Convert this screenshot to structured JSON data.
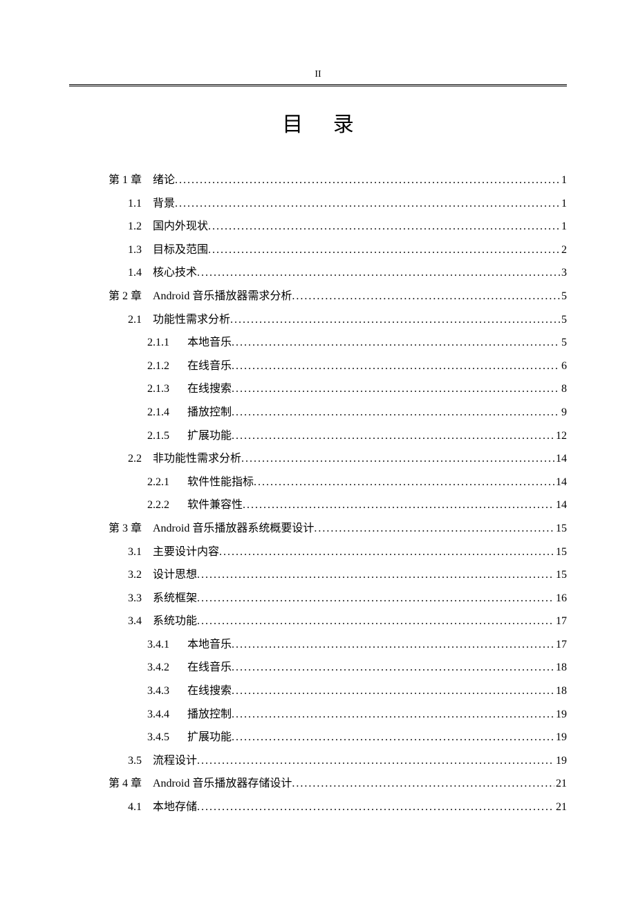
{
  "header": {
    "pageNumber": "II"
  },
  "title": "目 录",
  "toc": [
    {
      "level": 1,
      "label": "第 1 章",
      "text": "绪论",
      "page": "1"
    },
    {
      "level": 2,
      "label": "1.1",
      "text": "背景",
      "page": "1"
    },
    {
      "level": 2,
      "label": "1.2",
      "text": "国内外现状",
      "page": "1"
    },
    {
      "level": 2,
      "label": "1.3",
      "text": "目标及范围",
      "page": "2"
    },
    {
      "level": 2,
      "label": "1.4",
      "text": "核心技术",
      "page": "3"
    },
    {
      "level": 1,
      "label": "第 2 章",
      "text": "Android 音乐播放器需求分析",
      "page": "5"
    },
    {
      "level": 2,
      "label": "2.1",
      "text": "功能性需求分析",
      "page": "5"
    },
    {
      "level": 3,
      "label": "2.1.1",
      "text": "本地音乐",
      "page": "5"
    },
    {
      "level": 3,
      "label": "2.1.2",
      "text": "在线音乐",
      "page": "6"
    },
    {
      "level": 3,
      "label": "2.1.3",
      "text": "在线搜索",
      "page": "8"
    },
    {
      "level": 3,
      "label": "2.1.4",
      "text": "播放控制",
      "page": "9"
    },
    {
      "level": 3,
      "label": "2.1.5",
      "text": "扩展功能",
      "page": "12"
    },
    {
      "level": 2,
      "label": "2.2",
      "text": "非功能性需求分析",
      "page": "14"
    },
    {
      "level": 3,
      "label": "2.2.1",
      "text": "软件性能指标",
      "page": "14"
    },
    {
      "level": 3,
      "label": "2.2.2",
      "text": "软件兼容性",
      "page": "14"
    },
    {
      "level": 1,
      "label": "第 3 章",
      "text": "Android 音乐播放器系统概要设计",
      "page": "15"
    },
    {
      "level": 2,
      "label": "3.1",
      "text": "主要设计内容",
      "page": "15"
    },
    {
      "level": 2,
      "label": "3.2",
      "text": "设计思想",
      "page": "15"
    },
    {
      "level": 2,
      "label": "3.3",
      "text": "系统框架",
      "page": "16"
    },
    {
      "level": 2,
      "label": "3.4",
      "text": "系统功能",
      "page": "17"
    },
    {
      "level": 3,
      "label": "3.4.1",
      "text": "本地音乐",
      "page": "17"
    },
    {
      "level": 3,
      "label": "3.4.2",
      "text": "在线音乐",
      "page": "18"
    },
    {
      "level": 3,
      "label": "3.4.3",
      "text": "在线搜索",
      "page": "18"
    },
    {
      "level": 3,
      "label": "3.4.4",
      "text": "播放控制",
      "page": "19"
    },
    {
      "level": 3,
      "label": "3.4.5",
      "text": "扩展功能",
      "page": "19"
    },
    {
      "level": 2,
      "label": "3.5",
      "text": "流程设计",
      "page": "19"
    },
    {
      "level": 1,
      "label": "第 4 章",
      "text": "Android 音乐播放器存储设计",
      "page": "21"
    },
    {
      "level": 2,
      "label": "4.1",
      "text": "本地存储",
      "page": "21"
    }
  ]
}
